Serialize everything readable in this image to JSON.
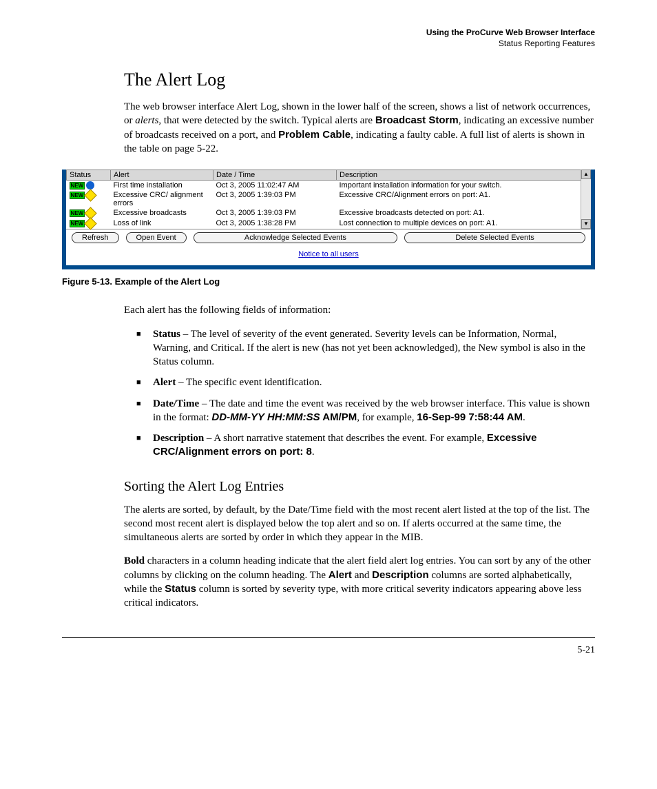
{
  "header": {
    "chapter": "Using the ProCurve Web Browser Interface",
    "section": "Status Reporting Features"
  },
  "title": "The Alert Log",
  "intro": {
    "t1": "The web browser interface Alert Log, shown in the lower half of the screen, shows a list of network occurrences, or ",
    "alerts_it": "alerts",
    "t2": ", that were detected by the switch. Typical alerts are ",
    "bs": "Broadcast Storm",
    "t3": ", indicating an excessive number of broadcasts received on a port, and ",
    "pc": "Problem Cable",
    "t4": ", indicating a faulty cable. A full list of alerts is shown in the table on page 5-22."
  },
  "figure": {
    "caption": "Figure 5-13. Example of the Alert Log",
    "columns": {
      "status": "Status",
      "alert": "Alert",
      "datetime": "Date / Time",
      "desc": "Description"
    },
    "rows": [
      {
        "sev": "info",
        "alert": "First time installation",
        "dt": "Oct 3, 2005 11:02:47 AM",
        "desc": "Important installation information for your switch."
      },
      {
        "sev": "warn",
        "alert": "Excessive CRC/\nalignment errors",
        "dt": "Oct 3, 2005 1:39:03 PM",
        "desc": "Excessive CRC/Alignment errors on port: A1."
      },
      {
        "sev": "warn",
        "alert": "Excessive broadcasts",
        "dt": "Oct 3, 2005 1:39:03 PM",
        "desc": "Excessive broadcasts detected on port: A1."
      },
      {
        "sev": "warn",
        "alert": "Loss of link",
        "dt": "Oct 3, 2005 1:38:28 PM",
        "desc": "Lost connection to multiple devices on port: A1."
      }
    ],
    "new_badge": "NEW",
    "buttons": {
      "refresh": "Refresh",
      "open": "Open Event",
      "ack": "Acknowledge Selected Events",
      "del": "Delete Selected Events"
    },
    "notice": "Notice to all users"
  },
  "fields_intro": "Each alert has the following fields of information:",
  "fields": {
    "status": {
      "label": "Status",
      "text": " – The level of severity of the event generated. Severity levels can be Information, Normal, Warning, and Critical. If the alert is new (has not yet been acknowledged), the New symbol is also in the Status column."
    },
    "alert": {
      "label": "Alert",
      "text": " – The specific event identification."
    },
    "datetime": {
      "label": "Date/Time",
      "t1": " – The date and time the event was received by the web browser interface. This value is shown in the format: ",
      "fmt": "DD-MM-YY HH:MM:SS",
      "ampm": " AM/PM",
      "t2": ", for example, ",
      "example": "16-Sep-99 7:58:44 AM",
      "t3": "."
    },
    "desc": {
      "label": "Description",
      "t1": " – A short narrative statement that describes the event. For example, ",
      "example": "Excessive CRC/Alignment errors on port: 8",
      "t2": "."
    }
  },
  "sort": {
    "heading": "Sorting the Alert Log Entries",
    "p1": "The alerts are sorted, by default, by the Date/Time field with the most recent alert listed at the top of the list. The second most recent alert is displayed below the top alert and so on. If alerts occurred at the same time, the simultaneous alerts are sorted by order in which they appear in the MIB.",
    "p2a": "Bold",
    "p2b": " characters in a column heading indicate that the alert field alert log entries. You can sort by any of the other columns by clicking on the column heading. The ",
    "alert_b": "Alert",
    "p2c": " and ",
    "desc_b": "Description",
    "p2d": " columns are sorted alphabetically, while the ",
    "status_b": "Status",
    "p2e": " column is sorted by severity type, with more critical severity indicators appearing above less critical indicators."
  },
  "pagenum": "5-21"
}
